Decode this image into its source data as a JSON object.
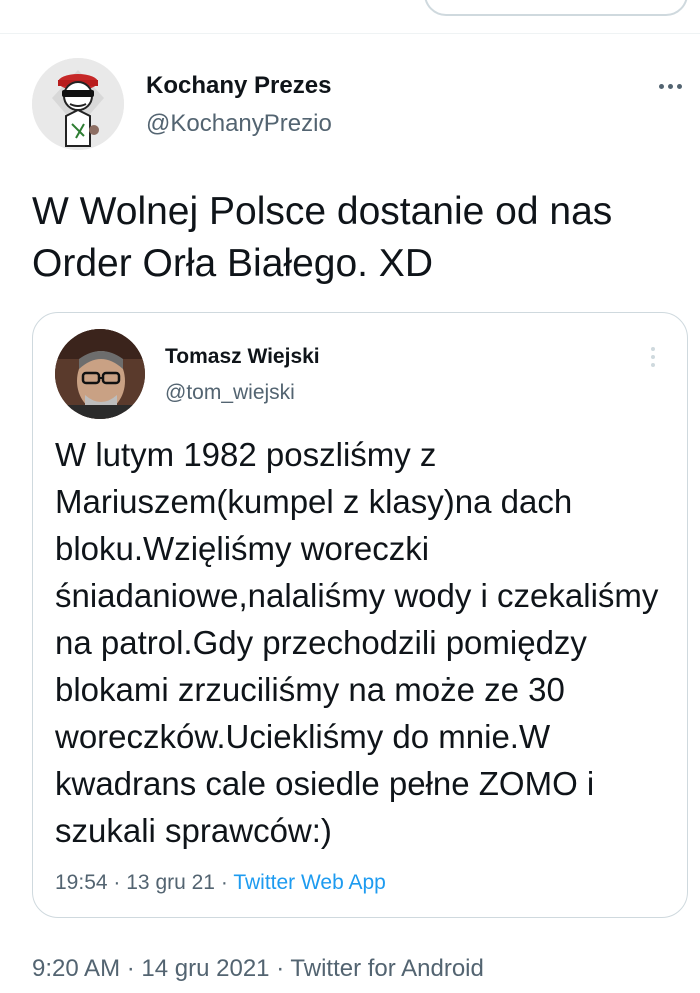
{
  "tweet": {
    "author_name": "Kochany Prezes",
    "author_handle": "@KochanyPrezio",
    "text": "W Wolnej Polsce dostanie od nas Order Orła Białego. XD",
    "time": "9:20 AM",
    "date": "14 gru 2021",
    "source": "Twitter for Android",
    "separator": "·"
  },
  "quoted": {
    "author_name": "Tomasz Wiejski",
    "author_handle": "@tom_wiejski",
    "text": "W lutym 1982 poszliśmy z Mariuszem(kumpel z klasy)na dach bloku.Wzięliśmy woreczki śniadaniowe,nalaliśmy wody i czekaliśmy na patrol.Gdy przechodzili pomiędzy blokami zrzuciliśmy na może ze 30 woreczków.Uciekliśmy do mnie.W kwadrans cale osiedle pełne ZOMO i szukali sprawców:)",
    "time": "19:54",
    "date": "13 gru 21",
    "source": "Twitter Web App",
    "separator": "·"
  },
  "colors": {
    "text": "#0f1419",
    "secondary": "#536471",
    "link": "#1d9bf0",
    "border": "#cfd9de"
  },
  "icons": {
    "more": "more-horizontal-icon",
    "quote_more": "more-vertical-icon"
  }
}
